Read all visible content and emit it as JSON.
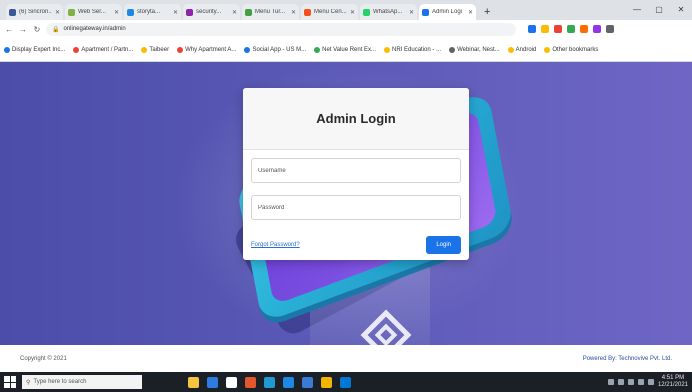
{
  "browser": {
    "tabs": [
      {
        "label": "(6) Sincron...",
        "color": "#3b5998",
        "active": false
      },
      {
        "label": "Web Ser...",
        "color": "#7cb342",
        "active": false
      },
      {
        "label": "storyta...",
        "color": "#1e88e5",
        "active": false
      },
      {
        "label": "security...",
        "color": "#8e24aa",
        "active": false
      },
      {
        "label": "Menu Tur...",
        "color": "#43a047",
        "active": false
      },
      {
        "label": "Menu Cen...",
        "color": "#f4511e",
        "active": false
      },
      {
        "label": "WhatsAp...",
        "color": "#25d366",
        "active": false
      },
      {
        "label": "Admin Logi",
        "color": "#1a73e8",
        "active": true
      }
    ],
    "new_tab_label": "+",
    "window_controls": [
      "—",
      "▢",
      "✕"
    ],
    "address": "onlinegateway.in/admin",
    "extension_colors": [
      "#1a73e8",
      "#fbbc04",
      "#ea4335",
      "#34a853",
      "#ff6d00",
      "#9334e6",
      "#5f6368"
    ],
    "bookmarks": [
      {
        "label": "Display Expert Inc...",
        "color": "#1a73e8"
      },
      {
        "label": "Apartment / Partn...",
        "color": "#ea4335"
      },
      {
        "label": "Taibeer",
        "color": "#fbbc04"
      },
      {
        "label": "Why Apartment A...",
        "color": "#ea4335"
      },
      {
        "label": "Social App - US M...",
        "color": "#1a73e8"
      },
      {
        "label": "Net Value Rent Ex...",
        "color": "#34a853"
      },
      {
        "label": "NRI Education - ...",
        "color": "#fbbc04"
      },
      {
        "label": "Webinar, Nest...",
        "color": "#5f6368"
      },
      {
        "label": "Android",
        "color": "#fbbc04"
      },
      {
        "label": "Other bookmarks",
        "color": "#fbbc04"
      }
    ]
  },
  "login": {
    "title": "Admin Login",
    "username_placeholder": "Username",
    "password_placeholder": "Password",
    "forgot_label": "Forgot Password?",
    "button_label": "Login",
    "accent_color": "#1a73e8"
  },
  "footer": {
    "copyright": "Copyright © 2021",
    "powered_by": "Powered By: Technovive Pvt. Ltd."
  },
  "taskbar": {
    "search_placeholder": "Type here to search",
    "pinned_colors": [
      "#f5c542",
      "#2d7de1",
      "#ffffff",
      "#e4572e",
      "#1f9bd1",
      "#1e88e5",
      "#3a7bd5",
      "#f4b400",
      "#0078d4"
    ],
    "time": "4:51 PM",
    "date": "12/21/2021"
  }
}
